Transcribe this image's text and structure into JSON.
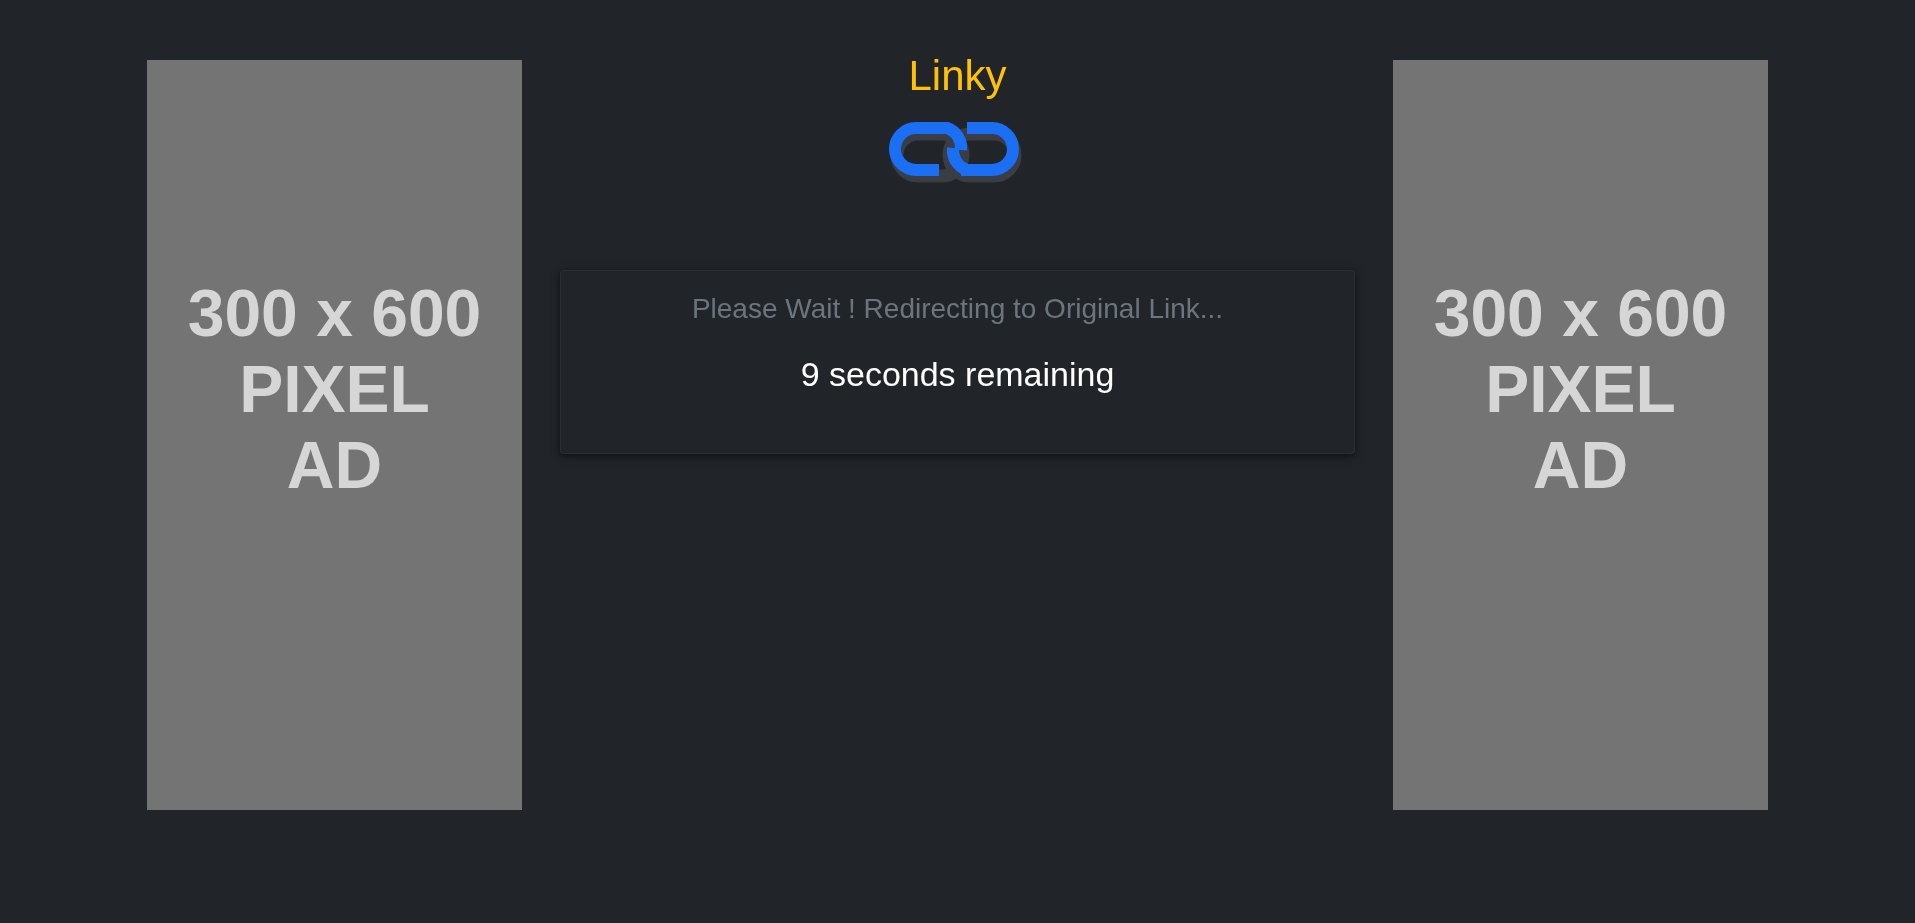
{
  "ads": [
    {
      "text": "300 x 600\nPIXEL\nAD"
    },
    {
      "text": "300 x 600\nPIXEL\nAD"
    }
  ],
  "brand": {
    "title": "Linky"
  },
  "card": {
    "message": "Please Wait ! Redirecting to Original Link...",
    "countdown": "9 seconds remaining"
  }
}
